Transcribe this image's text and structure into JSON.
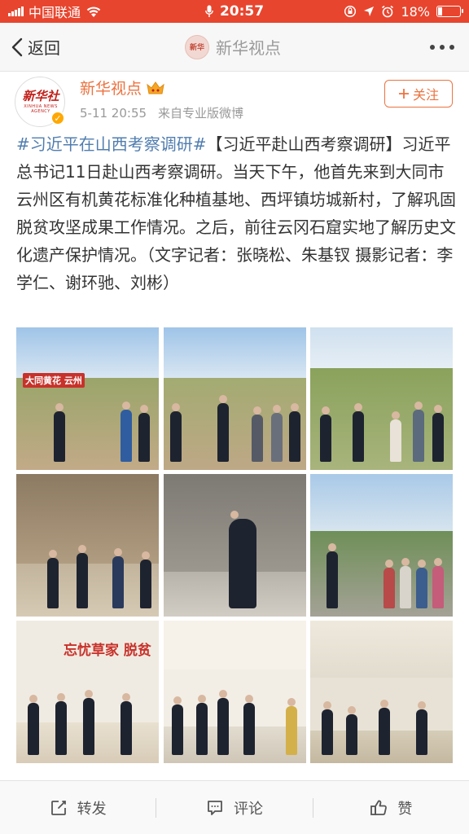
{
  "status_bar": {
    "carrier": "中国联通",
    "time": "20:57",
    "battery": "18%",
    "battery_level": 0.18,
    "icons": [
      "signal-icon",
      "wifi-icon",
      "microphone-icon",
      "rotation-lock-icon",
      "location-icon",
      "alarm-icon",
      "battery-icon"
    ]
  },
  "nav": {
    "back_label": "返回",
    "title": "新华视点",
    "more_icon": "more-dots-icon"
  },
  "post": {
    "author": "新华视点",
    "avatar_logo": "新华社",
    "avatar_logo_sub": "XINHUA NEWS AGENCY",
    "time": "5-11 20:55",
    "source": "来自专业版微博",
    "follow_label": "关注",
    "hashtag": "#习近平在山西考察调研#",
    "body": "【习近平赴山西考察调研】习近平总书记11日赴山西考察调研。当天下午，他首先来到大同市云州区有机黄花标准化种植基地、西坪镇坊城新村，了解巩固脱贫攻坚成果工作情况。之后，前往云冈石窟实地了解历史文化遗产保护情况。（文字记者：张晓松、朱基钗 摄影记者：李学仁、谢环驰、刘彬）",
    "photo_signs": {
      "field_sign": "大同黄花 云州",
      "wall_text": "忘忧草家 脱贫"
    }
  },
  "bottom_bar": {
    "repost": "转发",
    "comment": "评论",
    "like": "赞"
  },
  "colors": {
    "status_bar": "#e8452e",
    "author": "#eb7340",
    "hashtag": "#507daf"
  }
}
